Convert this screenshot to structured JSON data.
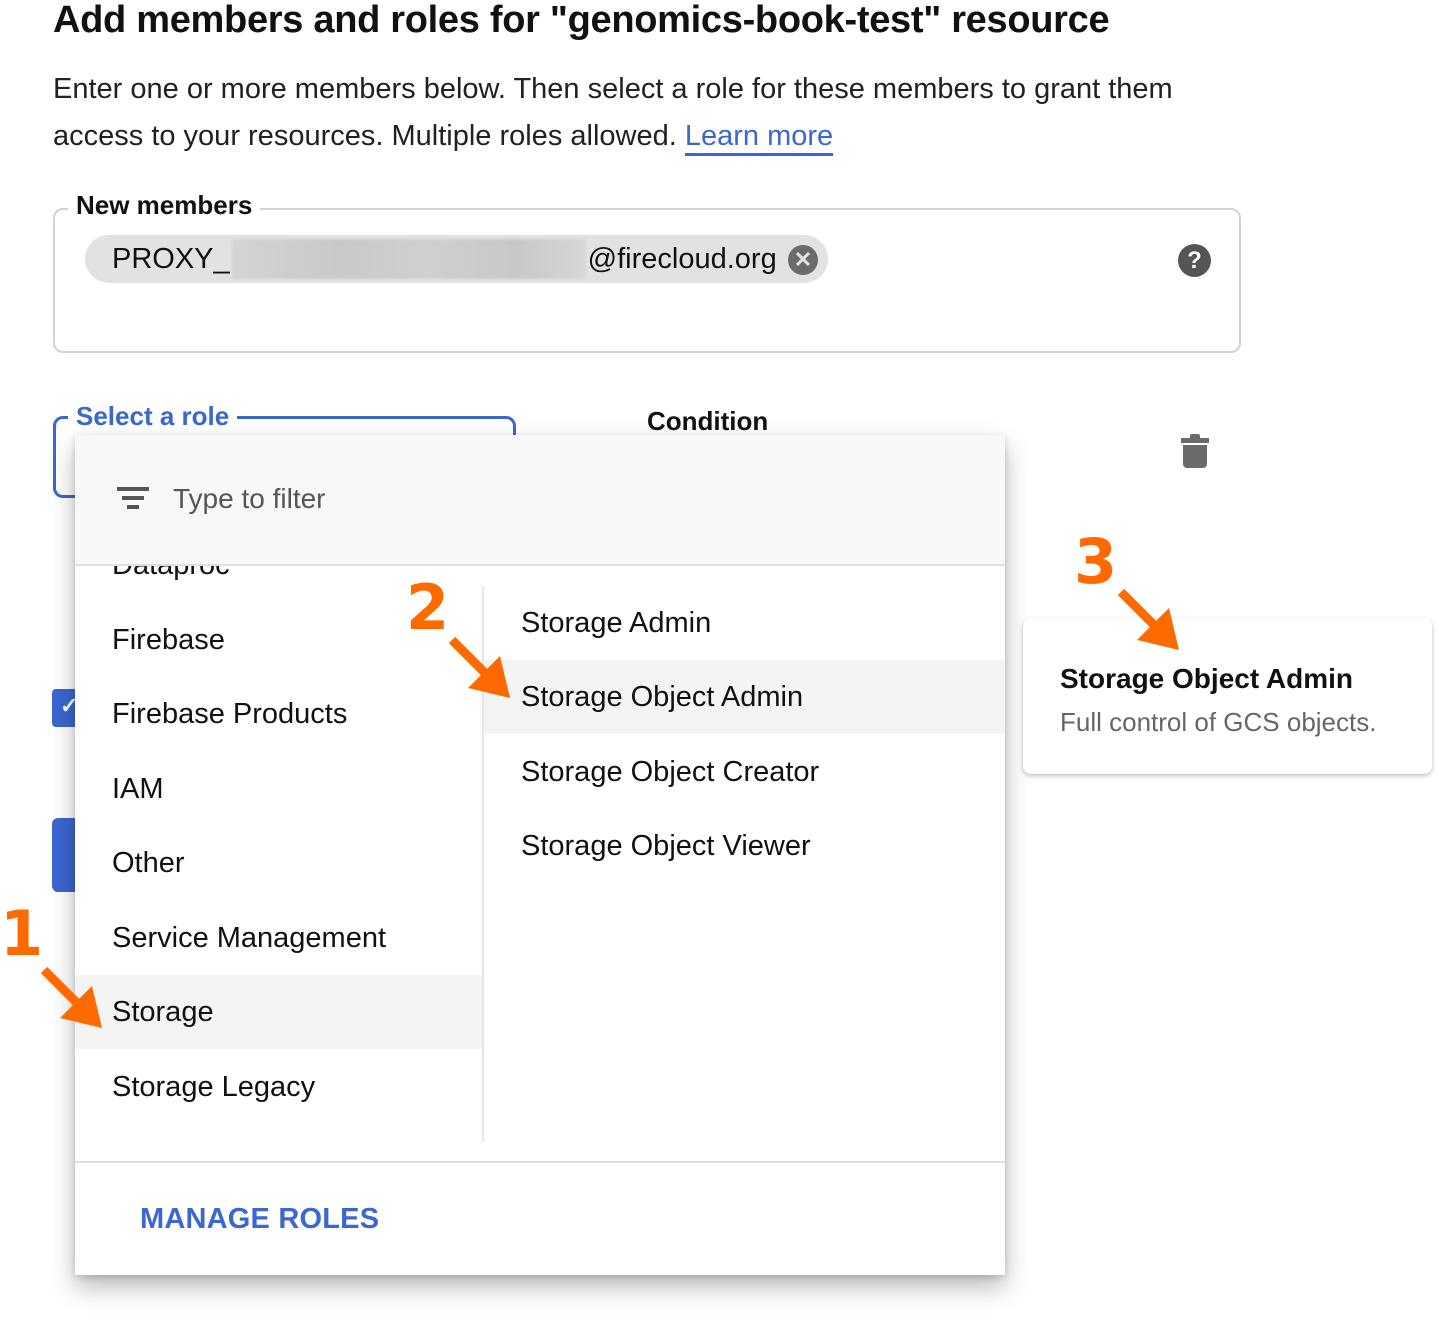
{
  "page": {
    "title": "Add members and roles for \"genomics-book-test\" resource",
    "intro_text": "Enter one or more members below. Then select a role for these members to grant them access to your resources. Multiple roles allowed.",
    "learn_more": "Learn more"
  },
  "members": {
    "legend": "New members",
    "chip": {
      "prefix": "PROXY_",
      "suffix": "@firecloud.org",
      "redacted": true,
      "close_icon": "cancel-circle-icon"
    },
    "help_icon": "help-circle-icon",
    "help_glyph": "?"
  },
  "role": {
    "legend": "Select a role",
    "condition_label": "Condition",
    "delete_icon": "trash-icon"
  },
  "dropdown": {
    "filter_placeholder": "Type to filter",
    "filter_icon": "filter-list-icon",
    "categories": [
      {
        "label": "Dataproc",
        "active": false
      },
      {
        "label": "Firebase",
        "active": false
      },
      {
        "label": "Firebase Products",
        "active": false
      },
      {
        "label": "IAM",
        "active": false
      },
      {
        "label": "Other",
        "active": false
      },
      {
        "label": "Service Management",
        "active": false
      },
      {
        "label": "Storage",
        "active": true
      },
      {
        "label": "Storage Legacy",
        "active": false
      }
    ],
    "roles": [
      {
        "label": "Storage Admin",
        "active": false
      },
      {
        "label": "Storage Object Admin",
        "active": true
      },
      {
        "label": "Storage Object Creator",
        "active": false
      },
      {
        "label": "Storage Object Viewer",
        "active": false
      }
    ],
    "manage_roles": "MANAGE ROLES"
  },
  "tooltip": {
    "title": "Storage Object Admin",
    "description": "Full control of GCS objects."
  },
  "annotations": [
    {
      "number": "1",
      "target": "Storage"
    },
    {
      "number": "2",
      "target": "Storage Object Admin"
    },
    {
      "number": "3",
      "target": "tooltip"
    }
  ],
  "colors": {
    "accent": "#3b67d2",
    "annotation": "#ff6a00",
    "active_row": "#f4f4f4"
  }
}
